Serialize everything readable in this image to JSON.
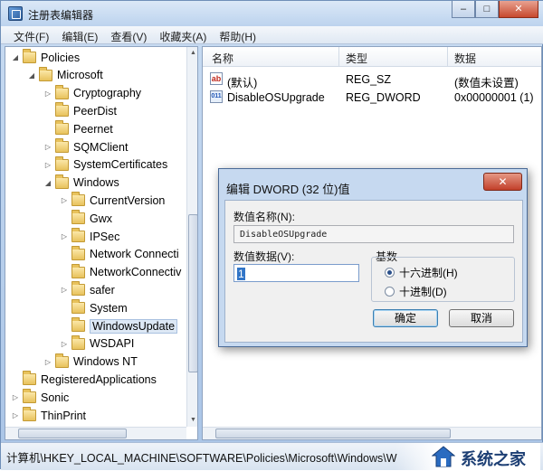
{
  "window": {
    "title": "注册表编辑器",
    "minimize": "–",
    "maximize": "□",
    "close": "✕"
  },
  "menu": [
    "文件(F)",
    "编辑(E)",
    "查看(V)",
    "收藏夹(A)",
    "帮助(H)"
  ],
  "tree": [
    {
      "label": "Policies",
      "expander": "◢",
      "level": 0
    },
    {
      "label": "Microsoft",
      "expander": "◢",
      "level": 1
    },
    {
      "label": "Cryptography",
      "expander": "▷",
      "level": 2
    },
    {
      "label": "PeerDist",
      "expander": "",
      "level": 2
    },
    {
      "label": "Peernet",
      "expander": "",
      "level": 2
    },
    {
      "label": "SQMClient",
      "expander": "▷",
      "level": 2
    },
    {
      "label": "SystemCertificates",
      "expander": "▷",
      "level": 2
    },
    {
      "label": "Windows",
      "expander": "◢",
      "level": 2
    },
    {
      "label": "CurrentVersion",
      "expander": "▷",
      "level": 3
    },
    {
      "label": "Gwx",
      "expander": "",
      "level": 3
    },
    {
      "label": "IPSec",
      "expander": "▷",
      "level": 3
    },
    {
      "label": "Network Connecti",
      "expander": "",
      "level": 3
    },
    {
      "label": "NetworkConnectiv",
      "expander": "",
      "level": 3
    },
    {
      "label": "safer",
      "expander": "▷",
      "level": 3
    },
    {
      "label": "System",
      "expander": "",
      "level": 3
    },
    {
      "label": "WindowsUpdate",
      "expander": "",
      "level": 3,
      "selected": true
    },
    {
      "label": "WSDAPI",
      "expander": "▷",
      "level": 3
    },
    {
      "label": "Windows NT",
      "expander": "▷",
      "level": 2
    },
    {
      "label": "RegisteredApplications",
      "expander": "",
      "level": 0
    },
    {
      "label": "Sonic",
      "expander": "▷",
      "level": 0
    },
    {
      "label": "ThinPrint",
      "expander": "▷",
      "level": 0
    }
  ],
  "list": {
    "headers": {
      "name": "名称",
      "type": "类型",
      "data": "数据"
    },
    "rows": [
      {
        "icon": "ab",
        "name": "(默认)",
        "type": "REG_SZ",
        "data": "(数值未设置)"
      },
      {
        "icon": "011",
        "name": "DisableOSUpgrade",
        "type": "REG_DWORD",
        "data": "0x00000001 (1)"
      }
    ]
  },
  "status": {
    "path": "计算机\\HKEY_LOCAL_MACHINE\\SOFTWARE\\Policies\\Microsoft\\Windows\\W",
    "watermark": "系统之家"
  },
  "dialog": {
    "title": "编辑 DWORD (32 位)值",
    "close": "✕",
    "name_label": "数值名称(N):",
    "name_value": "DisableOSUpgrade",
    "data_label": "数值数据(V):",
    "data_value": "1",
    "base_label": "基数",
    "radio_hex": "十六进制(H)",
    "radio_dec": "十进制(D)",
    "selected_base": "hex",
    "ok": "确定",
    "cancel": "取消"
  }
}
